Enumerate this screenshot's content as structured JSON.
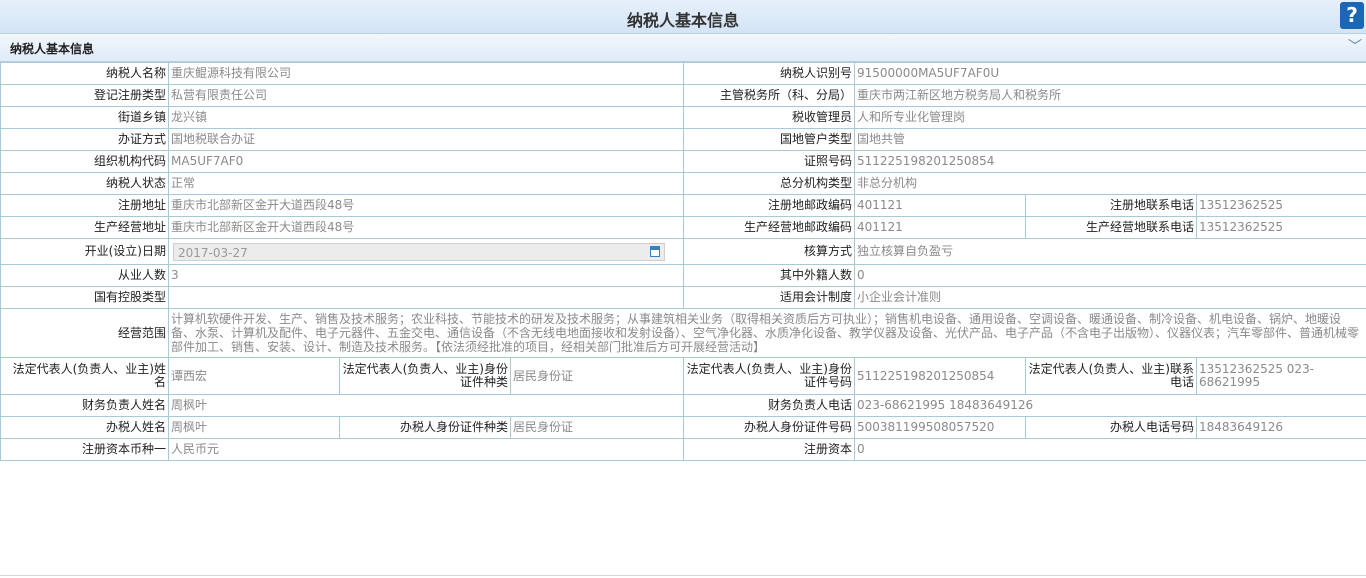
{
  "header": {
    "title": "纳税人基本信息",
    "help_label": "?"
  },
  "section": {
    "title": "纳税人基本信息"
  },
  "fields": {
    "nsrmc_label": "纳税人名称",
    "nsrmc": "重庆鲲源科技有限公司",
    "nsrsbh_label": "纳税人识别号",
    "nsrsbh": "91500000MA5UF7AF0U",
    "djzclx_label": "登记注册类型",
    "djzclx": "私营有限责任公司",
    "zgswjg_label": "主管税务所（科、分局）",
    "zgswjg": "重庆市两江新区地方税务局人和税务所",
    "jdxz_label": "街道乡镇",
    "jdxz": "龙兴镇",
    "sszgy_label": "税收管理员",
    "sszgy": "人和所专业化管理岗",
    "bzfs_label": "办证方式",
    "bzfs": "国地税联合办证",
    "gdghlx_label": "国地管户类型",
    "gdghlx": "国地共管",
    "zzjgdm_label": "组织机构代码",
    "zzjgdm": "MA5UF7AF0",
    "zzhm_label": "证照号码",
    "zzhm": "511225198201250854",
    "nsrzt_label": "纳税人状态",
    "nsrzt": "正常",
    "zfjglx_label": "总分机构类型",
    "zfjglx": "非总分机构",
    "zcdz_label": "注册地址",
    "zcdz": "重庆市北部新区金开大道西段48号",
    "zcyb_label": "注册地邮政编码",
    "zcyb": "401121",
    "zcdh_label": "注册地联系电话",
    "zcdh": "13512362525",
    "scdz_label": "生产经营地址",
    "scdz": "重庆市北部新区金开大道西段48号",
    "scyb_label": "生产经营地邮政编码",
    "scyb": "401121",
    "scdh_label": "生产经营地联系电话",
    "scdh": "13512362525",
    "kyrq_label": "开业(设立)日期",
    "kyrq": "2017-03-27",
    "hsfs_label": "核算方式",
    "hsfs": "独立核算自负盈亏",
    "cyrs_label": "从业人数",
    "cyrs": "3",
    "wjrs_label": "其中外籍人数",
    "wjrs": "0",
    "gykg_label": "国有控股类型",
    "gykg": "",
    "kjzd_label": "适用会计制度",
    "kjzd": "小企业会计准则",
    "jyfw_label": "经营范围",
    "jyfw": "计算机软硬件开发、生产、销售及技术服务；农业科技、节能技术的研发及技术服务；从事建筑相关业务（取得相关资质后方可执业）；销售机电设备、通用设备、空调设备、暖通设备、制冷设备、机电设备、锅炉、地暖设备、水泵、计算机及配件、电子元器件、五金交电、通信设备（不含无线电地面接收和发射设备）、空气净化器、水质净化设备、教学仪器及设备、光伏产品、电子产品（不含电子出版物）、仪器仪表；汽车零部件、普通机械零部件加工、销售、安装、设计、制造及技术服务。【依法须经批准的项目，经相关部门批准后方可开展经营活动】",
    "fddb_label": "法定代表人(负责人、业主)姓名",
    "fddb": "谭西宏",
    "fdzjzl_label": "法定代表人(负责人、业主)身份证件种类",
    "fdzjzl": "居民身份证",
    "fdzjhm_label": "法定代表人(负责人、业主)身份证件号码",
    "fdzjhm": "511225198201250854",
    "fddh_label": "法定代表人(负责人、业主)联系电话",
    "fddh": "13512362525 023-68621995",
    "cwfzr_label": "财务负责人姓名",
    "cwfzr": "周枫叶",
    "cwdh_label": "财务负责人电话",
    "cwdh": "023-68621995 18483649126",
    "bsr_label": "办税人姓名",
    "bsr": "周枫叶",
    "bsrzjzl_label": "办税人身份证件种类",
    "bsrzjzl": "居民身份证",
    "bsrzjhm_label": "办税人身份证件号码",
    "bsrzjhm": "500381199508057520",
    "bsrdh_label": "办税人电话号码",
    "bsrdh": "18483649126",
    "zczbbz_label": "注册资本币种一",
    "zczbbz": "人民币元",
    "zczb_label": "注册资本",
    "zczb": "0"
  }
}
